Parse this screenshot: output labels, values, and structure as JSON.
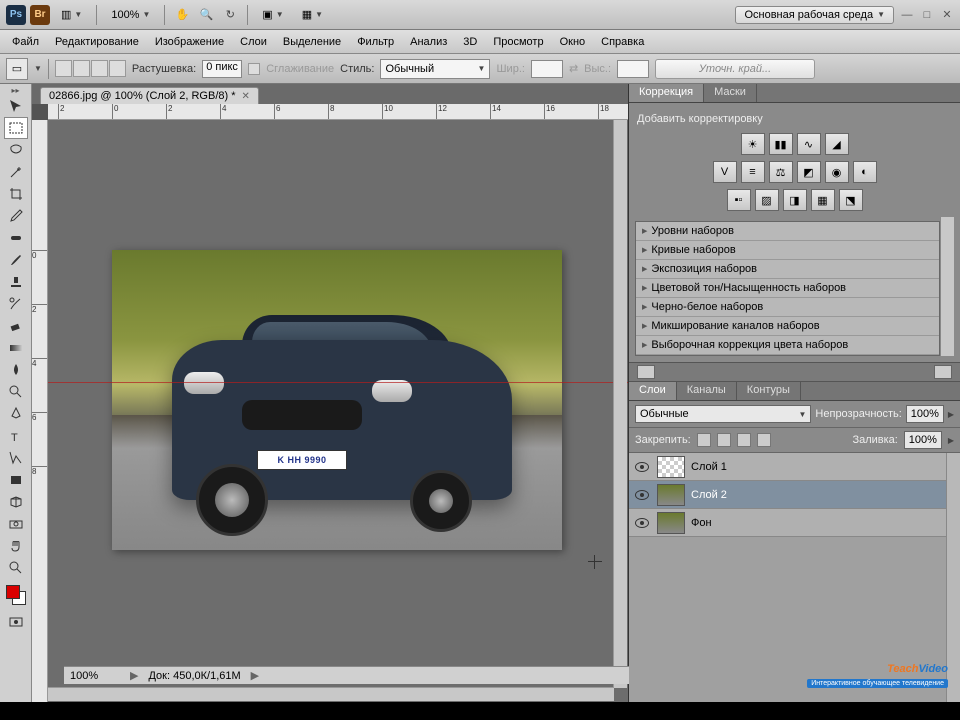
{
  "top": {
    "zoom": "100%",
    "workspace": "Основная рабочая среда"
  },
  "menu": [
    "Файл",
    "Редактирование",
    "Изображение",
    "Слои",
    "Выделение",
    "Фильтр",
    "Анализ",
    "3D",
    "Просмотр",
    "Окно",
    "Справка"
  ],
  "options": {
    "feather_label": "Растушевка:",
    "feather_value": "0 пикс",
    "antialias": "Сглаживание",
    "style_label": "Стиль:",
    "style_value": "Обычный",
    "width_label": "Шир.:",
    "height_label": "Выс.:",
    "refine": "Уточн. край..."
  },
  "doc": {
    "tab": "02866.jpg @ 100% (Слой 2, RGB/8) *",
    "plate": "K HH 9990"
  },
  "ruler_h": [
    "2",
    "0",
    "2",
    "4",
    "6",
    "8",
    "10",
    "12",
    "14",
    "16",
    "18"
  ],
  "ruler_v": [
    "0",
    "2",
    "4",
    "6",
    "8"
  ],
  "adjustments": {
    "tab1": "Коррекция",
    "tab2": "Маски",
    "heading": "Добавить корректировку",
    "presets": [
      "Уровни наборов",
      "Кривые наборов",
      "Экспозиция наборов",
      "Цветовой тон/Насыщенность наборов",
      "Черно-белое наборов",
      "Микширование каналов наборов",
      "Выборочная коррекция цвета наборов"
    ]
  },
  "layers": {
    "tab1": "Слои",
    "tab2": "Каналы",
    "tab3": "Контуры",
    "blend": "Обычные",
    "opacity_label": "Непрозрачность:",
    "opacity": "100%",
    "lock_label": "Закрепить:",
    "fill_label": "Заливка:",
    "fill": "100%",
    "items": [
      {
        "name": "Слой 1",
        "sel": false,
        "bg": false
      },
      {
        "name": "Слой 2",
        "sel": true,
        "bg": false
      },
      {
        "name": "Фон",
        "sel": false,
        "bg": true
      }
    ]
  },
  "status": {
    "zoom": "100%",
    "doc_size": "Док: 450,0К/1,61М"
  },
  "watermark": {
    "t": "Teach",
    "v": "Video",
    "sub": "Интерактивное обучающее телевидение"
  }
}
